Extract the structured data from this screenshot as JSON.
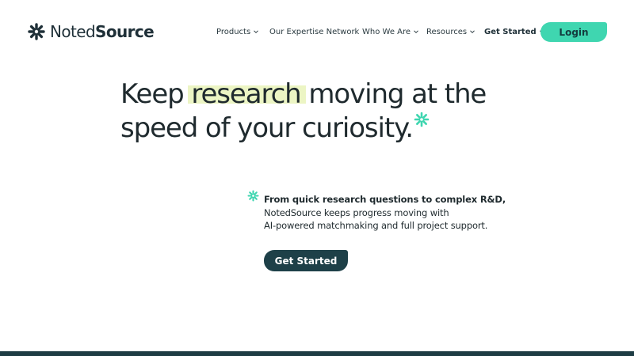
{
  "brand": {
    "name_regular": "Noted",
    "name_bold": "Source",
    "logo_icon": "asterisk-spark-icon",
    "colors": {
      "dark": "#1f3038",
      "accent": "#3fd6b0",
      "highlight": "#ecf5c4",
      "button_dark": "#1e4048"
    }
  },
  "nav": {
    "items": [
      {
        "label": "Products",
        "has_dropdown": true
      },
      {
        "label": "Our Expertise Network",
        "has_dropdown": false
      },
      {
        "label": "Who We Are",
        "has_dropdown": true
      },
      {
        "label": "Resources",
        "has_dropdown": true
      },
      {
        "label": "Get Started",
        "has_dropdown": true
      }
    ],
    "login_label": "Login"
  },
  "hero": {
    "title_before": "Keep ",
    "title_highlight": "research",
    "title_after_line1": " moving at the",
    "title_line2": "speed of your curiosity.",
    "sub_lead": "From quick research questions to complex R&D,",
    "sub_line2": "NotedSource keeps progress moving with",
    "sub_line3": "AI-powered matchmaking and full project support.",
    "cta_label": "Get Started"
  }
}
